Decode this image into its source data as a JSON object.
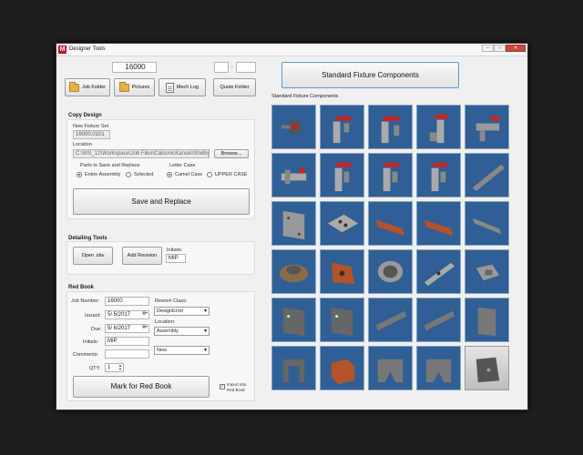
{
  "window": {
    "title": "Designer Tools",
    "app_icon_letter": "M"
  },
  "top": {
    "job_number": "16000",
    "range_from": "",
    "range_sep": "-",
    "range_to": "",
    "job_folder_label": "Job Folder",
    "pictures_label": "Pictures",
    "mech_log_label": "Mech Log",
    "quote_folder_label": "Quote Folder",
    "standard_fixture_button": "Standard Fixture Components"
  },
  "copy_design": {
    "heading": "Copy Design",
    "new_fixture_set_label": "New Fixture Set",
    "new_fixture_set_value": "16000.0101",
    "location_label": "Location",
    "location_value": "C:\\WS_12\\Workspace\\Job Files\\CalsonicKansei\\Shelbyville",
    "browse_label": "Browse...",
    "parts_label": "Parts to Save and Replace",
    "entire_assembly": "Entire Assembly",
    "selected": "Selected",
    "letter_case_label": "Letter Case",
    "camel_case": "Camel Case",
    "upper_case": "UPPER CASE",
    "save_replace": "Save and Replace"
  },
  "detailing": {
    "heading": "Detailing Tools",
    "open_idw": "Open .idw",
    "add_revision": "Add Revision",
    "initials_label": "Initials:",
    "initials_value": "MIP"
  },
  "red_book": {
    "heading": "Red Book",
    "job_number_label": "Job Number:",
    "job_number_value": "16000",
    "issued_label": "Issued:",
    "issued_value": "5/ 5/2017",
    "due_label": "Due:",
    "due_value": "5/ 6/2017",
    "initials_label": "Initials:",
    "initials_value": "MIP",
    "comments_label": "Comments:",
    "comments_value": "",
    "qty_label": "QTY:",
    "qty_value": "1",
    "rework_class_label": "Rework Class:",
    "rework_class_value": "DesignError",
    "location_label": "Location:",
    "location_value": "Assembly",
    "status_value": "New",
    "mark_button": "Mark for Red Book",
    "import_label_1": "Import into",
    "import_label_2": "Red Book"
  },
  "fixtures": {
    "heading": "Standard Fixture Components",
    "tile_count": 30
  },
  "colors": {
    "tile_bg": "#2f5f94",
    "accent_red": "#c8102e",
    "part_orange": "#b4532a"
  }
}
